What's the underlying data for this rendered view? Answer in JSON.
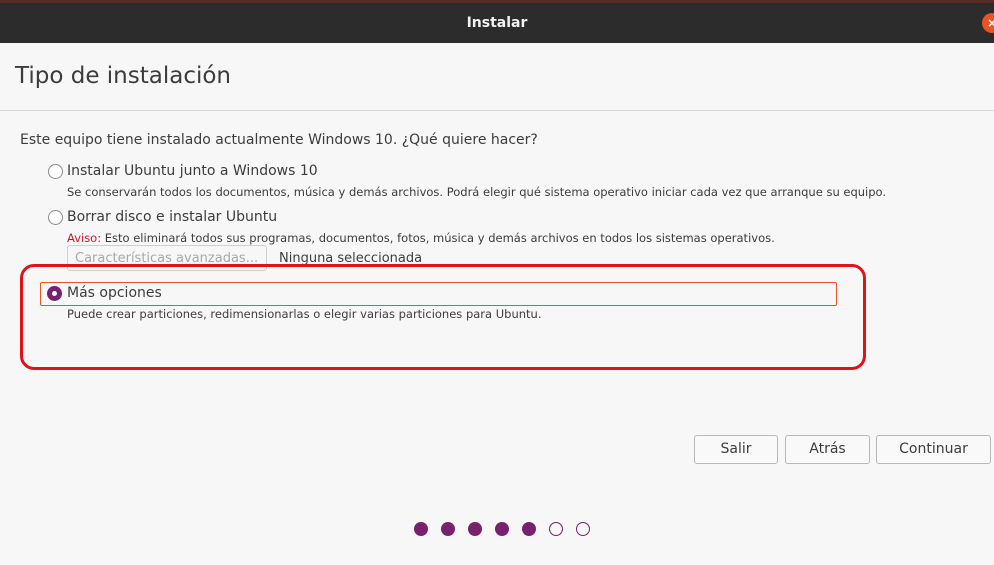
{
  "window": {
    "title": "Instalar",
    "close_glyph": "×"
  },
  "page": {
    "title": "Tipo de instalación",
    "question": "Este equipo tiene instalado actualmente Windows 10. ¿Qué quiere hacer?"
  },
  "options": [
    {
      "label": "Instalar Ubuntu junto a Windows 10",
      "description": "Se conservarán todos los documentos, música y demás archivos. Podrá elegir qué sistema operativo iniciar cada vez que arranque su equipo.",
      "selected": false
    },
    {
      "label": "Borrar disco e instalar Ubuntu",
      "warning_prefix": "Aviso:",
      "description": " Esto eliminará todos sus programas, documentos, fotos, música y demás archivos en todos los sistemas operativos.",
      "selected": false
    },
    {
      "label": "Más opciones",
      "description": "Puede crear particiones, redimensionarlas o elegir varias particiones para Ubuntu.",
      "selected": true
    }
  ],
  "advanced": {
    "button_label": "Características avanzadas...",
    "status": "Ninguna seleccionada"
  },
  "buttons": {
    "quit": "Salir",
    "back": "Atrás",
    "continue": "Continuar"
  },
  "progress": {
    "total_steps": 7,
    "completed_steps": 5
  },
  "colors": {
    "accent": "#77216f",
    "focus": "#e95420",
    "warning": "#c7162b",
    "annotation": "#e0131b"
  },
  "icons": {
    "close": "close-icon",
    "radio": "radio-icon"
  }
}
